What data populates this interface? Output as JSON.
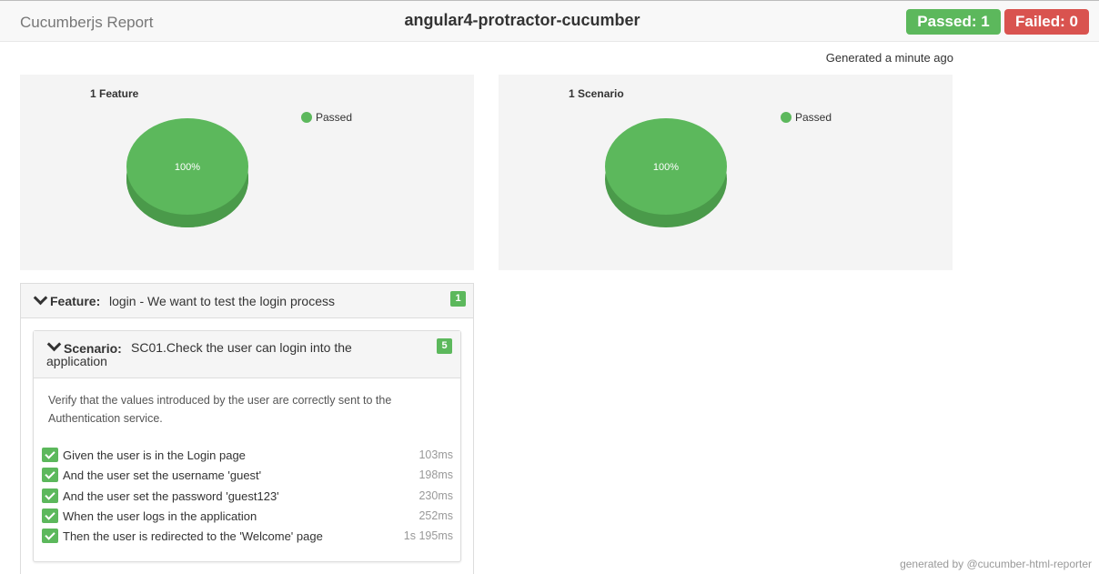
{
  "header": {
    "brand": "Cucumberjs Report",
    "project": "angular4-protractor-cucumber",
    "passed_label": "Passed: 1",
    "failed_label": "Failed: 0"
  },
  "generated_text": "Generated a minute ago",
  "colors": {
    "passed": "#5cb85c",
    "failed": "#d9534f"
  },
  "chart_data": [
    {
      "type": "pie",
      "title": "1 Feature",
      "legend": "top-right",
      "series": [
        {
          "name": "Passed",
          "values": [
            100
          ],
          "label": "100%"
        }
      ]
    },
    {
      "type": "pie",
      "title": "1 Scenario",
      "legend": "top-right",
      "series": [
        {
          "name": "Passed",
          "values": [
            100
          ],
          "label": "100%"
        }
      ]
    }
  ],
  "feature": {
    "keyword": "Feature:",
    "name": "login - We want to test the login process",
    "count": "1"
  },
  "scenario": {
    "keyword": "Scenario:",
    "name": "SC01.Check the user can login into the application",
    "count": "5",
    "description": "Verify that the values introduced by the user are correctly sent to the Authentication service.",
    "steps": [
      {
        "text": "Given the user is in the Login page",
        "duration": "103ms",
        "status": "passed"
      },
      {
        "text": "And the user set the username 'guest'",
        "duration": "198ms",
        "status": "passed"
      },
      {
        "text": "And the user set the password 'guest123'",
        "duration": "230ms",
        "status": "passed"
      },
      {
        "text": "When the user logs in the application",
        "duration": "252ms",
        "status": "passed"
      },
      {
        "text": "Then the user is redirected to the 'Welcome' page",
        "duration": "1s 195ms",
        "status": "passed"
      }
    ]
  },
  "footer": "generated by @cucumber-html-reporter"
}
